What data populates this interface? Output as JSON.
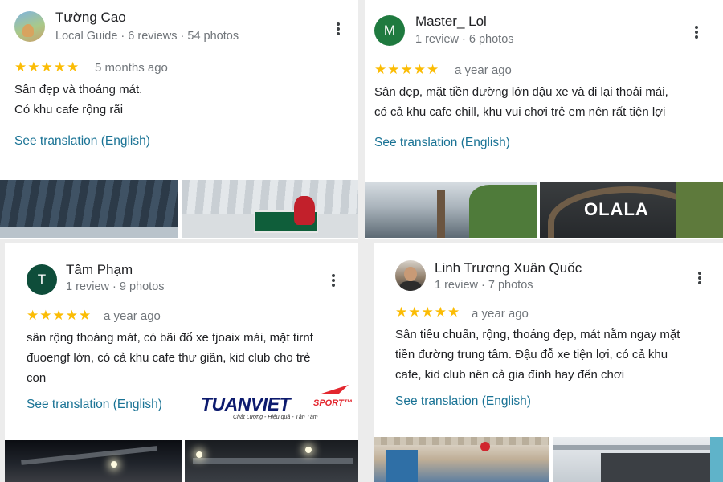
{
  "reviews": [
    {
      "name": "Tường Cao",
      "meta": "Local Guide · 6 reviews · 54 photos",
      "avatar": "",
      "stars": "★★★★★",
      "time": "5 months ago",
      "lines": [
        "Sân đẹp và thoáng mát.",
        "Có khu cafe rộng rãi"
      ],
      "translate": "See translation (English)"
    },
    {
      "name": "Master_ Lol",
      "meta": "1 review · 6 photos",
      "avatar": "M",
      "stars": "★★★★★",
      "time": "a year ago",
      "lines": [
        "Sân đẹp, mặt tiền đường lớn đậu xe và đi lại thoải mái,",
        "có cả khu cafe chill, khu vui chơi trẻ em nên rất tiện lợi"
      ],
      "translate": "See translation (English)",
      "photo_sign": "OLALA"
    },
    {
      "name": "Tâm Phạm",
      "meta": "1 review · 9 photos",
      "avatar": "T",
      "stars": "★★★★★",
      "time": "a year ago",
      "lines": [
        "sân rộng thoáng mát, có bãi đổ xe tjoaix mái, mặt tirnf",
        "đuoengf lớn, có cả khu cafe thư giãn, kid club cho trẻ",
        "con"
      ],
      "translate": "See translation (English)"
    },
    {
      "name": "Linh Trương Xuân Quốc",
      "meta": "1 review · 7 photos",
      "avatar": "",
      "stars": "★★★★★",
      "time": "a year ago",
      "lines": [
        "Sân tiêu chuẩn, rộng, thoáng đẹp, mát nằm ngay mặt",
        "tiền đường trung tâm. Đậu đỗ xe tiện lợi, có cả khu",
        "cafe, kid club nên cả gia đình hay đến chơi"
      ],
      "translate": "See translation (English)"
    }
  ],
  "logo": {
    "word": "TUANVIET",
    "sport": "SPORT™",
    "tagline": "Chất Lượng - Hiệu quả - Tận Tâm"
  },
  "colors": {
    "star": "#fbbc04",
    "link": "#1a7395",
    "avatar_m": "#1f7a3f",
    "avatar_t": "#0e4d3a",
    "logo_blue": "#0d1b6e",
    "logo_red": "#e3262e"
  }
}
